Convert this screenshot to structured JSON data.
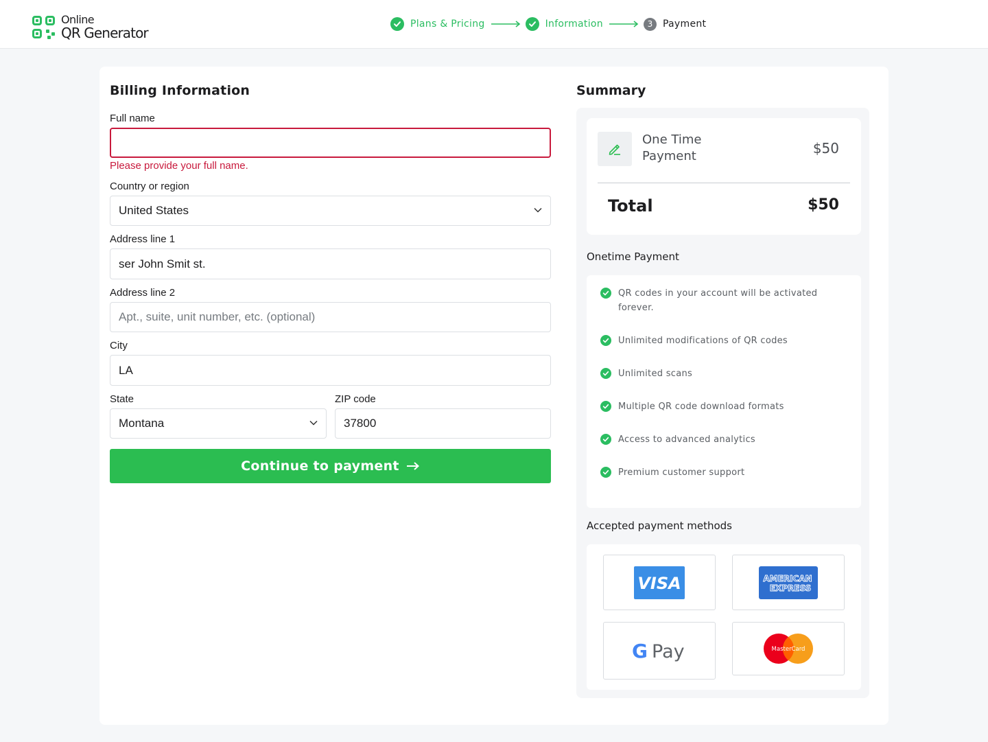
{
  "header": {
    "logo": {
      "line1": "Online",
      "line2": "QR Generator"
    },
    "steps": [
      {
        "label": "Plans & Pricing",
        "status": "done"
      },
      {
        "label": "Information",
        "status": "done"
      },
      {
        "number": "3",
        "label": "Payment",
        "status": "current"
      }
    ]
  },
  "billing": {
    "title": "Billing Information",
    "full_name": {
      "label": "Full name",
      "value": "",
      "error": "Please provide your full name."
    },
    "country": {
      "label": "Country or region",
      "value": "United States"
    },
    "address1": {
      "label": "Address line 1",
      "value": "ser John Smit st."
    },
    "address2": {
      "label": "Address line 2",
      "placeholder": "Apt., suite, unit number, etc. (optional)"
    },
    "city": {
      "label": "City",
      "value": "LA"
    },
    "state": {
      "label": "State",
      "value": "Montana"
    },
    "zip": {
      "label": "ZIP code",
      "value": "37800"
    },
    "continue_label": "Continue to payment"
  },
  "summary": {
    "title": "Summary",
    "plan_name": "One Time Payment",
    "plan_price": "$50",
    "total_label": "Total",
    "total_value": "$50",
    "features_heading": "Onetime Payment",
    "features": [
      "QR codes in your account will be activated forever.",
      "Unlimited modifications of QR codes",
      "Unlimited scans",
      "Multiple QR code download formats",
      "Access to advanced analytics",
      "Premium customer support"
    ],
    "methods_heading": "Accepted payment methods",
    "methods": [
      {
        "name": "VISA",
        "icon": "visa-logo"
      },
      {
        "name": "AMERICAN EXPRESS",
        "line1": "AMERICAN",
        "line2": "EXPRESS",
        "icon": "amex-logo"
      },
      {
        "name": "G Pay",
        "g": "G",
        "pay": "Pay",
        "icon": "google-pay-logo"
      },
      {
        "name": "MasterCard",
        "icon": "mastercard-logo"
      }
    ]
  },
  "colors": {
    "accent_green": "#2bbd51",
    "error_red": "#c8193c"
  }
}
